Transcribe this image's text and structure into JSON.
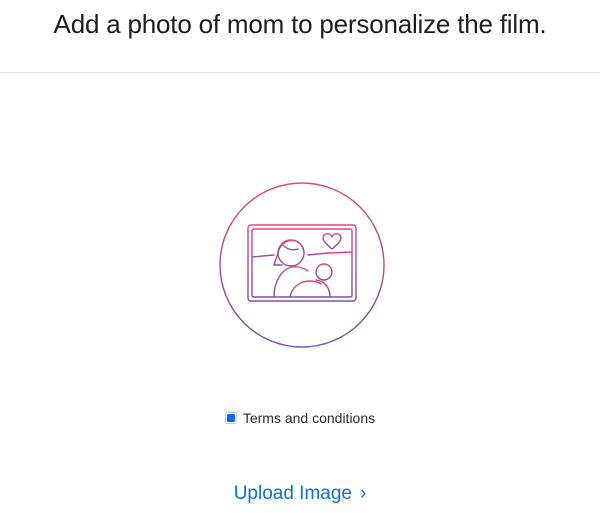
{
  "header": {
    "headline": "Add a photo of mom to personalize the film."
  },
  "illustration": {
    "icon": "photo-mom-child-heart-icon",
    "gradient_start": "#e4457b",
    "gradient_end": "#7c4fa8"
  },
  "terms": {
    "label": "Terms and conditions",
    "checked": true,
    "check_color": "#0a6fe6"
  },
  "upload": {
    "label": "Upload Image",
    "arrow": "›",
    "link_color": "#0a72d8"
  }
}
